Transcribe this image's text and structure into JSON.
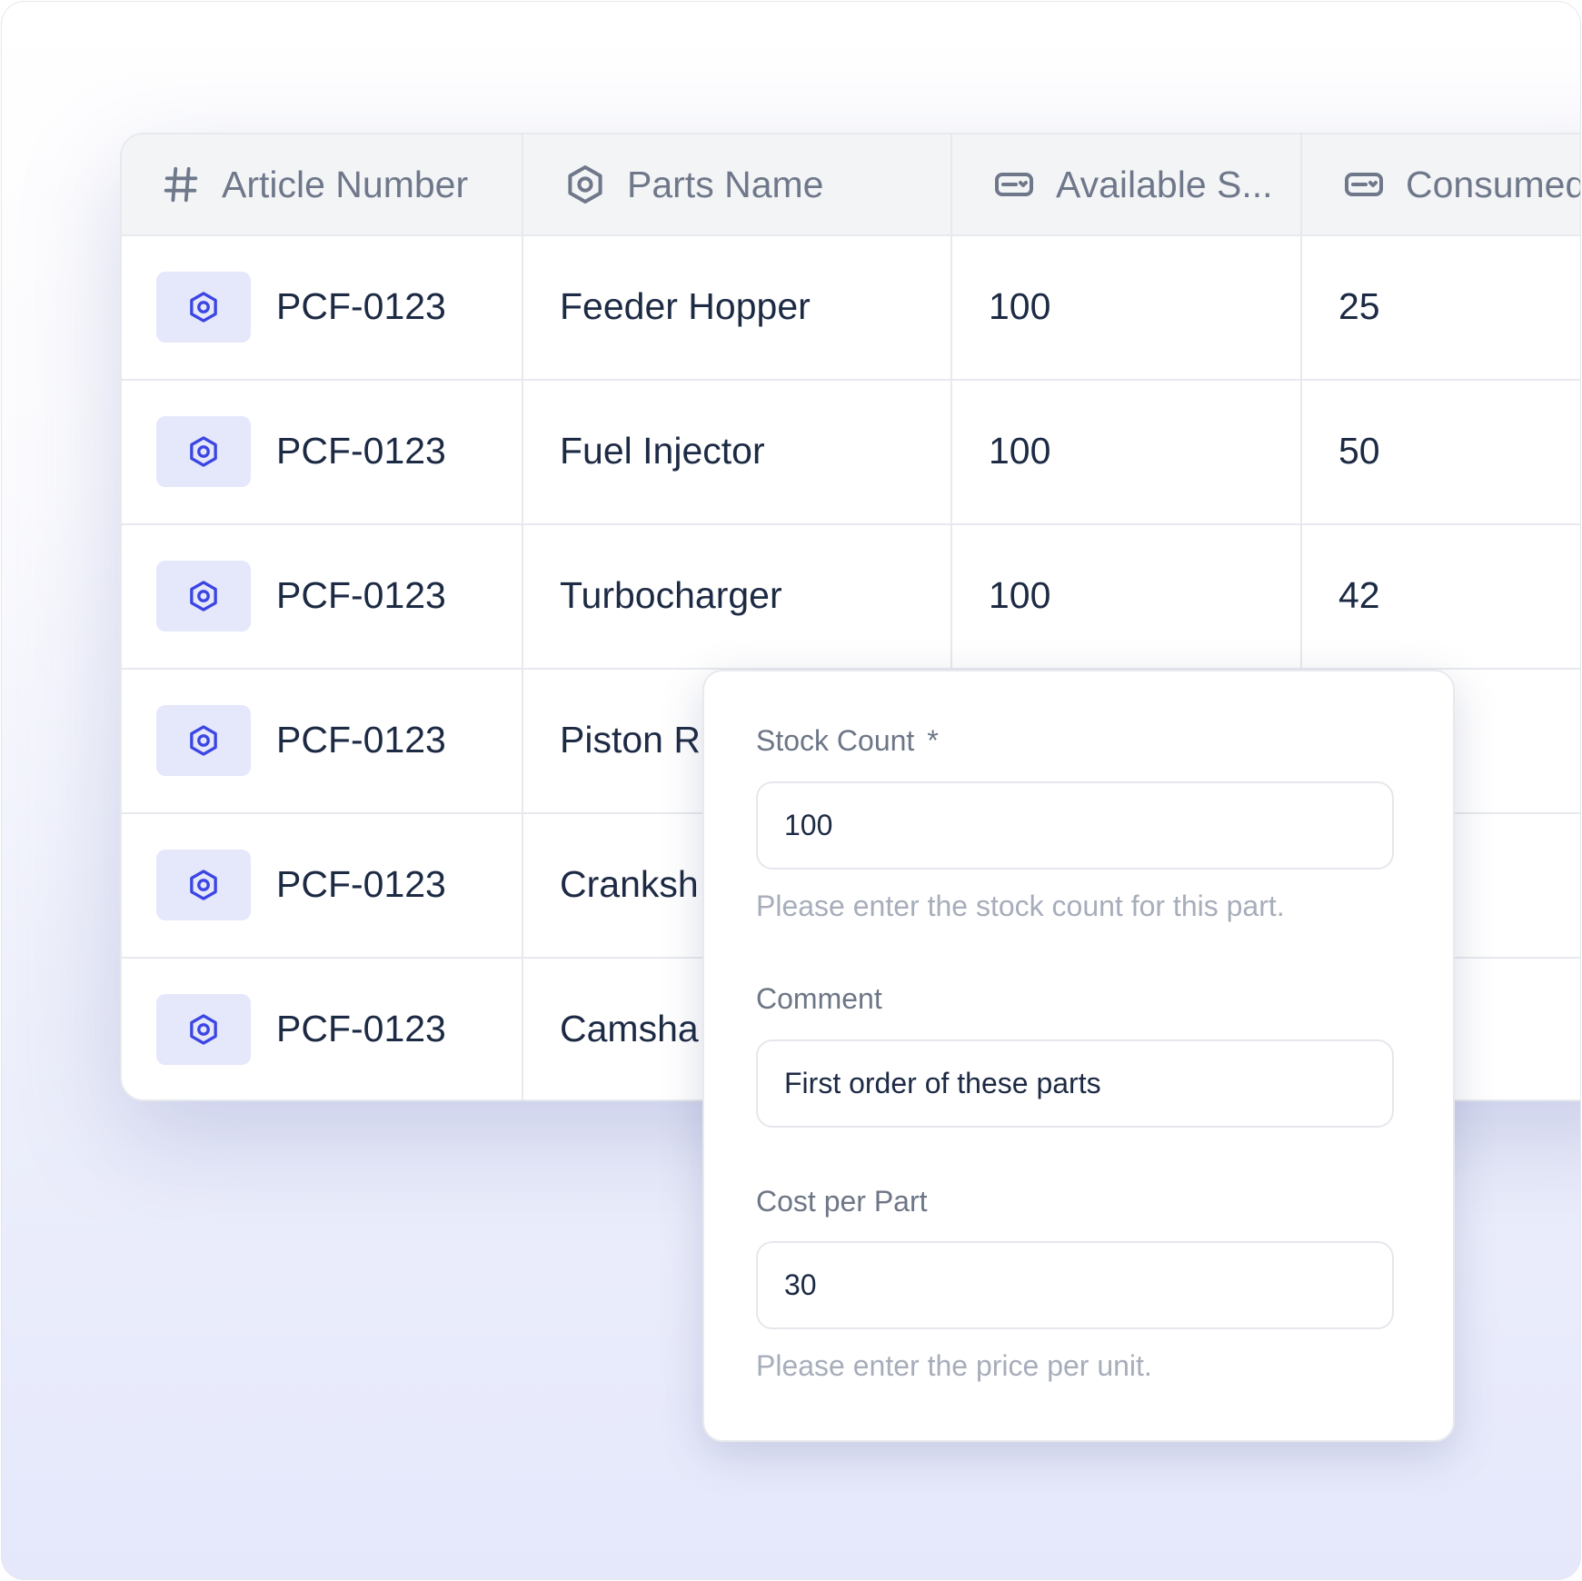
{
  "table": {
    "columns": [
      {
        "label": "Article Number",
        "icon": "hash-icon"
      },
      {
        "label": "Parts Name",
        "icon": "hexagon-nut-icon"
      },
      {
        "label": "Available S...",
        "icon": "stock-tag-icon"
      },
      {
        "label": "Consumed",
        "icon": "stock-tag-icon"
      }
    ],
    "rows": [
      {
        "article": "PCF-0123",
        "part": "Feeder Hopper",
        "available": "100",
        "consumed": "25"
      },
      {
        "article": "PCF-0123",
        "part": "Fuel Injector",
        "available": "100",
        "consumed": "50"
      },
      {
        "article": "PCF-0123",
        "part": "Turbocharger",
        "available": "100",
        "consumed": "42"
      },
      {
        "article": "PCF-0123",
        "part": "Piston R",
        "available": "",
        "consumed": ""
      },
      {
        "article": "PCF-0123",
        "part": "Cranksh",
        "available": "",
        "consumed": ""
      },
      {
        "article": "PCF-0123",
        "part": "Camsha",
        "available": "",
        "consumed": ""
      }
    ]
  },
  "form": {
    "stock_count": {
      "label": "Stock Count",
      "required_mark": "*",
      "value": "100",
      "help": "Please enter the stock count for this part."
    },
    "comment": {
      "label": "Comment",
      "value": "First order of these parts"
    },
    "cost_per_part": {
      "label": "Cost per Part",
      "value": "30",
      "help": "Please enter the price per unit."
    }
  },
  "colors": {
    "accent": "#3b45e3",
    "badge_bg": "#e5e7fb",
    "header_bg": "#f3f4f6",
    "text_dark": "#1d2a44",
    "text_muted": "#6f788a",
    "help_text": "#a7adba"
  }
}
